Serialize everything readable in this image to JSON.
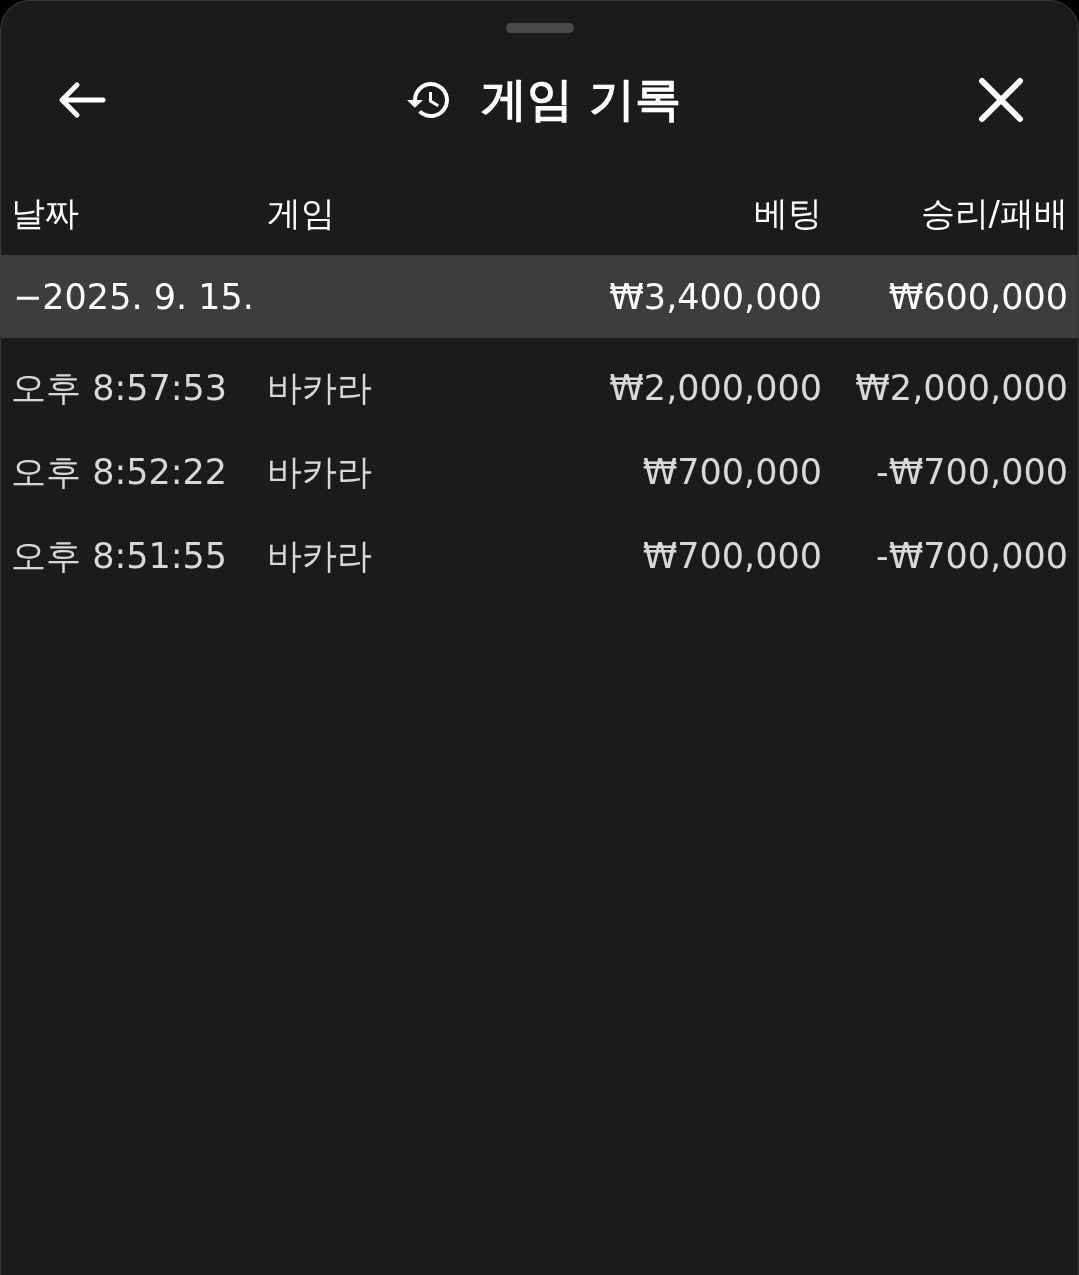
{
  "header": {
    "title": "게임 기록"
  },
  "table": {
    "columns": [
      "날짜",
      "게임",
      "베팅",
      "승리/패배"
    ],
    "groups": [
      {
        "date": "−2025. 9. 15.",
        "bet": "₩3,400,000",
        "result": "₩600,000",
        "expanded": true,
        "rows": [
          {
            "time": "오후 8:57:53",
            "game": "바카라",
            "bet": "₩2,000,000",
            "result": "₩2,000,000"
          },
          {
            "time": "오후 8:52:22",
            "game": "바카라",
            "bet": "₩700,000",
            "result": "-₩700,000"
          },
          {
            "time": "오후 8:51:55",
            "game": "바카라",
            "bet": "₩700,000",
            "result": "-₩700,000"
          }
        ]
      }
    ]
  }
}
